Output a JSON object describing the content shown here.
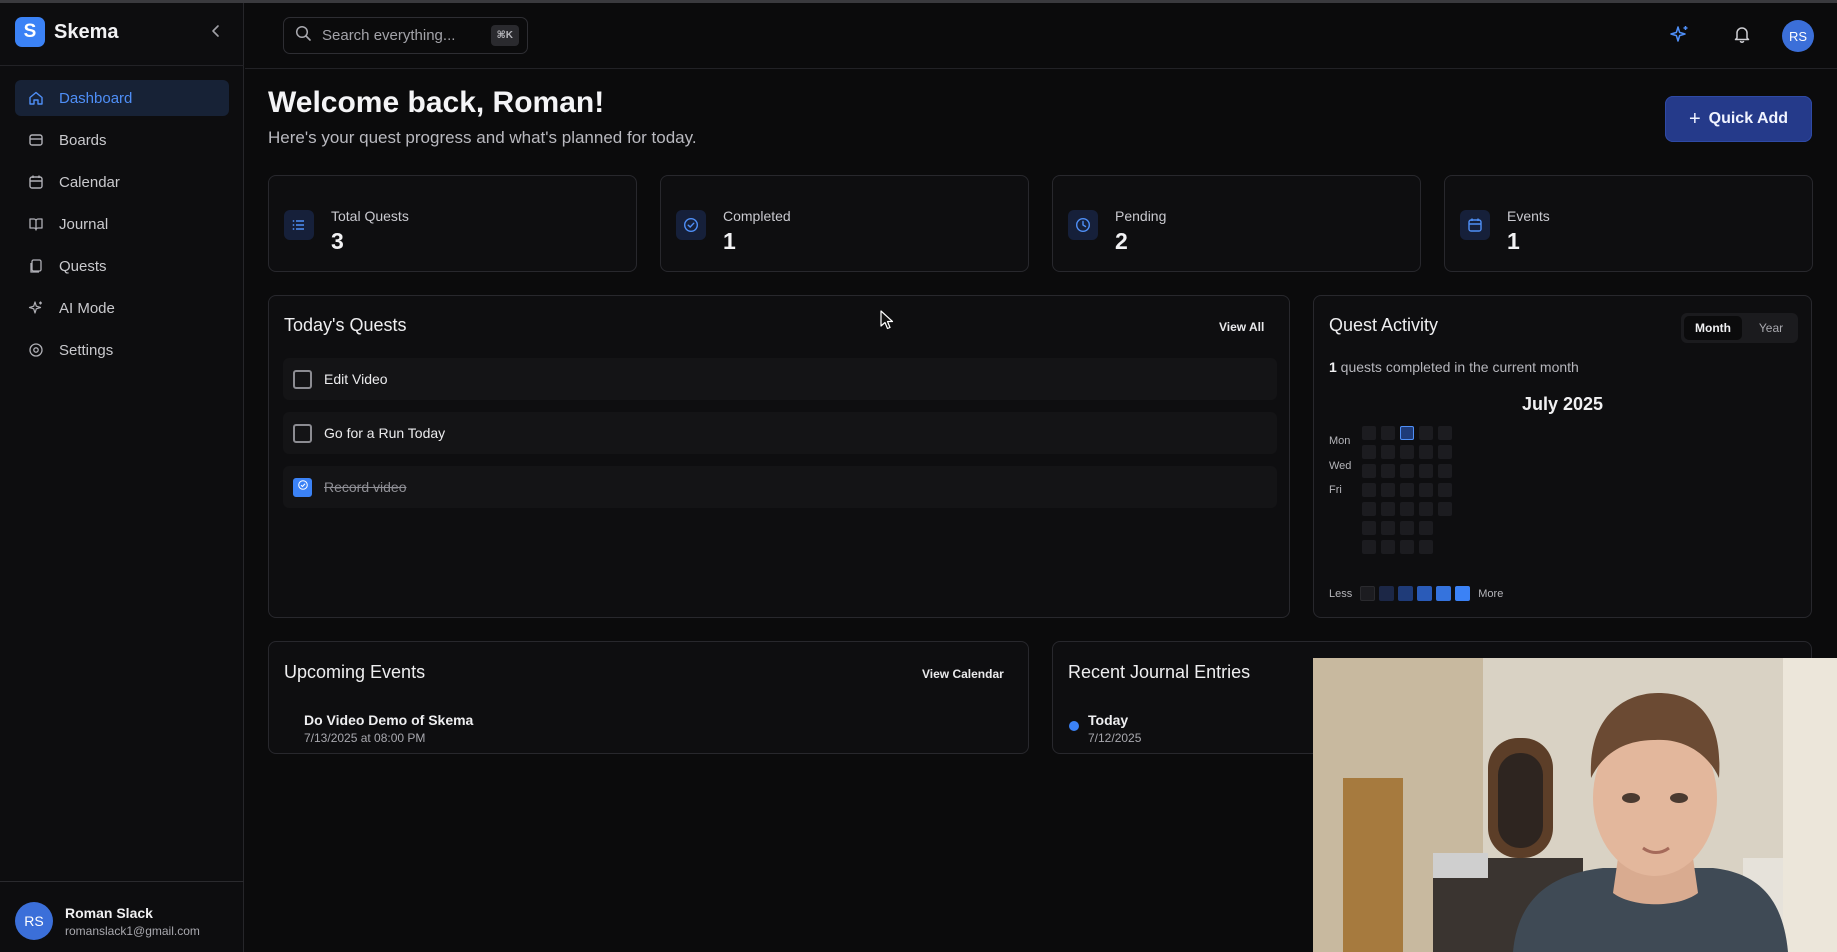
{
  "app": {
    "name": "Skema",
    "logo_letter": "S"
  },
  "sidebar": {
    "items": [
      {
        "label": "Dashboard",
        "icon": "home-icon",
        "active": true
      },
      {
        "label": "Boards",
        "icon": "archive-icon"
      },
      {
        "label": "Calendar",
        "icon": "calendar-icon"
      },
      {
        "label": "Journal",
        "icon": "book-icon"
      },
      {
        "label": "Quests",
        "icon": "files-icon"
      },
      {
        "label": "AI Mode",
        "icon": "sparkles-icon"
      },
      {
        "label": "Settings",
        "icon": "gear-icon"
      }
    ],
    "user": {
      "initials": "RS",
      "name": "Roman Slack",
      "email": "romanslack1@gmail.com"
    }
  },
  "header": {
    "search_placeholder": "Search everything...",
    "shortcut": "⌘K",
    "avatar_initials": "RS"
  },
  "main": {
    "welcome": "Welcome back, Roman!",
    "subtitle": "Here's your quest progress and what's planned for today.",
    "quick_add": "Quick Add",
    "stats": [
      {
        "label": "Total Quests",
        "value": "3",
        "icon": "list-icon"
      },
      {
        "label": "Completed",
        "value": "1",
        "icon": "check-circle-icon"
      },
      {
        "label": "Pending",
        "value": "2",
        "icon": "clock-icon"
      },
      {
        "label": "Events",
        "value": "1",
        "icon": "calendar-icon"
      }
    ],
    "todays_quests": {
      "title": "Today's Quests",
      "view_all": "View All",
      "items": [
        {
          "label": "Edit Video",
          "done": false
        },
        {
          "label": "Go for a Run Today",
          "done": false
        },
        {
          "label": "Record video",
          "done": true
        }
      ]
    },
    "quest_activity": {
      "title": "Quest Activity",
      "tabs": [
        "Month",
        "Year"
      ],
      "active_tab": "Month",
      "summary_count": "1",
      "summary_text": " quests completed in the current month",
      "month": "July 2025",
      "day_labels": [
        "Mon",
        "Wed",
        "Fri"
      ],
      "legend_less": "Less",
      "legend_more": "More",
      "legend_colors": [
        "#1c1c20",
        "#1c2746",
        "#1f3b78",
        "#2a5bb8",
        "#3573dd",
        "#3b82f6"
      ]
    },
    "upcoming_events": {
      "title": "Upcoming Events",
      "view_calendar": "View Calendar",
      "items": [
        {
          "title": "Do Video Demo of Skema",
          "date": "7/13/2025 at 08:00 PM"
        }
      ]
    },
    "journal": {
      "title": "Recent Journal Entries",
      "items": [
        {
          "title": "Today",
          "date": "7/12/2025"
        }
      ]
    }
  },
  "colors": {
    "accent": "#3b82f6",
    "background": "#0b0b0c",
    "card_border": "#28282d"
  }
}
